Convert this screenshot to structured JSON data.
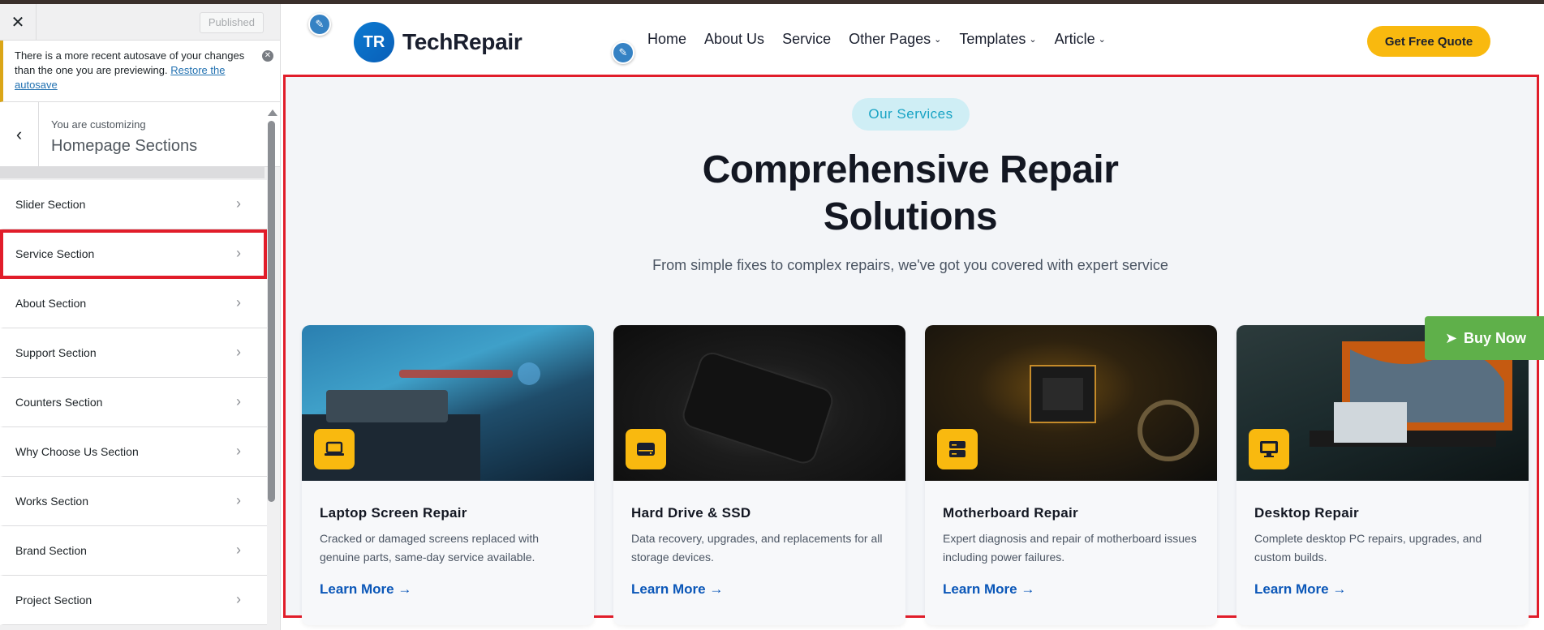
{
  "sidebar": {
    "close_icon": "close-icon",
    "published_label": "Published",
    "notice": {
      "text": "There is a more recent autosave of your changes than the one you are previewing.",
      "link": "Restore the autosave"
    },
    "customizing_label": "You are customizing",
    "section_title": "Homepage Sections",
    "items": [
      {
        "label": "Slider Section"
      },
      {
        "label": "Service Section"
      },
      {
        "label": "About Section"
      },
      {
        "label": "Support Section"
      },
      {
        "label": "Counters Section"
      },
      {
        "label": "Why Choose Us Section"
      },
      {
        "label": "Works Section"
      },
      {
        "label": "Brand Section"
      },
      {
        "label": "Project Section"
      }
    ]
  },
  "header": {
    "logo_mark": "TR",
    "logo_text": "TechRepair",
    "nav": [
      {
        "label": "Home",
        "dropdown": false
      },
      {
        "label": "About Us",
        "dropdown": false
      },
      {
        "label": "Service",
        "dropdown": false
      },
      {
        "label": "Other Pages",
        "dropdown": true
      },
      {
        "label": "Templates",
        "dropdown": true
      },
      {
        "label": "Article",
        "dropdown": true
      }
    ],
    "cta_label": "Get Free Quote"
  },
  "services": {
    "badge": "Our Services",
    "title": "Comprehensive Repair Solutions",
    "subtitle": "From simple fixes to complex repairs, we've got you covered with expert service",
    "cards": [
      {
        "title": "Laptop Screen Repair",
        "desc": "Cracked or damaged screens replaced with genuine parts, same-day service available.",
        "link": "Learn More →",
        "icon": "laptop-icon"
      },
      {
        "title": "Hard Drive & SSD",
        "desc": "Data recovery, upgrades, and replacements for all storage devices.",
        "link": "Learn More →",
        "icon": "hard-drive-icon"
      },
      {
        "title": "Motherboard Repair",
        "desc": "Expert diagnosis and repair of motherboard issues including power failures.",
        "link": "Learn More →",
        "icon": "server-icon"
      },
      {
        "title": "Desktop Repair",
        "desc": "Complete desktop PC repairs, upgrades, and custom builds.",
        "link": "Learn More →",
        "icon": "monitor-icon"
      }
    ]
  },
  "buy_now_label": "Buy Now",
  "colors": {
    "accent": "#f9b90f",
    "link": "#0b57b8",
    "highlight": "#e11d2a",
    "buy_now": "#5fb04a"
  }
}
